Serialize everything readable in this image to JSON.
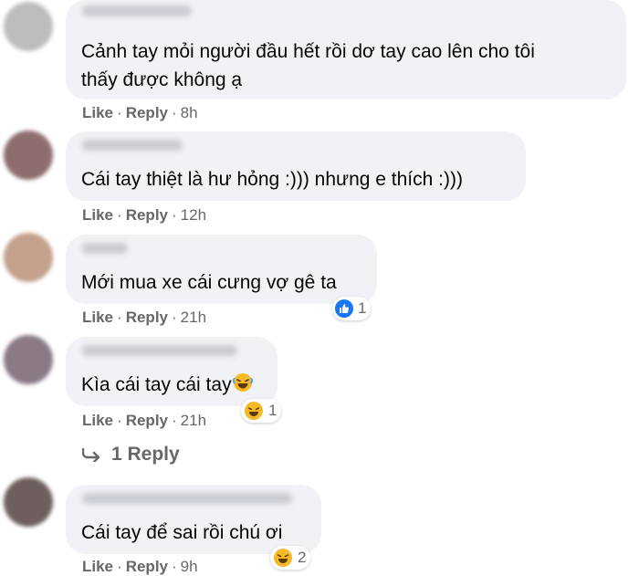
{
  "comments": [
    {
      "text_lines": [
        "Cảnh tay mỏi người đầu hết rồi dơ tay cao lên cho tôi",
        "thấy được không ạ"
      ],
      "like_label": "Like",
      "reply_label": "Reply",
      "time": "8h",
      "reaction": null
    },
    {
      "text_lines": [
        "Cái tay thiệt là hư hỏng :))) nhưng e thích :)))"
      ],
      "like_label": "Like",
      "reply_label": "Reply",
      "time": "12h",
      "reaction": null
    },
    {
      "text_lines": [
        "Mới mua xe cái cưng vợ gê ta"
      ],
      "like_label": "Like",
      "reply_label": "Reply",
      "time": "21h",
      "reaction": {
        "icon": "like-icon",
        "count": "1"
      }
    },
    {
      "text_lines": [
        "Kìa cái tay cái tay"
      ],
      "inline_emoji": "laughing-tears-emoji",
      "like_label": "Like",
      "reply_label": "Reply",
      "time": "21h",
      "reaction": {
        "icon": "haha-icon",
        "count": "1"
      },
      "replies_link": "1 Reply"
    },
    {
      "text_lines": [
        "Cái tay để sai rồi chú ơi"
      ],
      "like_label": "Like",
      "reply_label": "Reply",
      "time": "9h",
      "reaction": {
        "icon": "haha-icon",
        "count": "2"
      }
    }
  ],
  "separator": "·",
  "colors": {
    "bubble": "#f0f2f5",
    "meta": "#65676b",
    "like_blue": "#1877f2",
    "haha_yellow": "#f7b928"
  }
}
